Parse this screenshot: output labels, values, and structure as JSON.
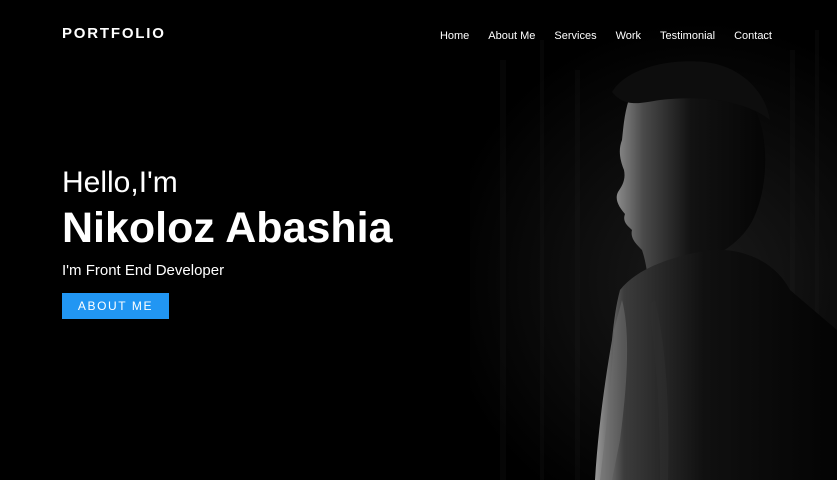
{
  "header": {
    "logo": "PORTFOLIO",
    "nav": [
      {
        "label": "Home"
      },
      {
        "label": "About Me"
      },
      {
        "label": "Services"
      },
      {
        "label": "Work"
      },
      {
        "label": "Testimonial"
      },
      {
        "label": "Contact"
      }
    ]
  },
  "hero": {
    "greeting": "Hello,I'm",
    "name": "Nikoloz Abashia",
    "role": "I'm Front End Developer",
    "cta_label": "ABOUT ME"
  },
  "colors": {
    "background": "#000000",
    "accent": "#2196f3",
    "text": "#ffffff"
  }
}
